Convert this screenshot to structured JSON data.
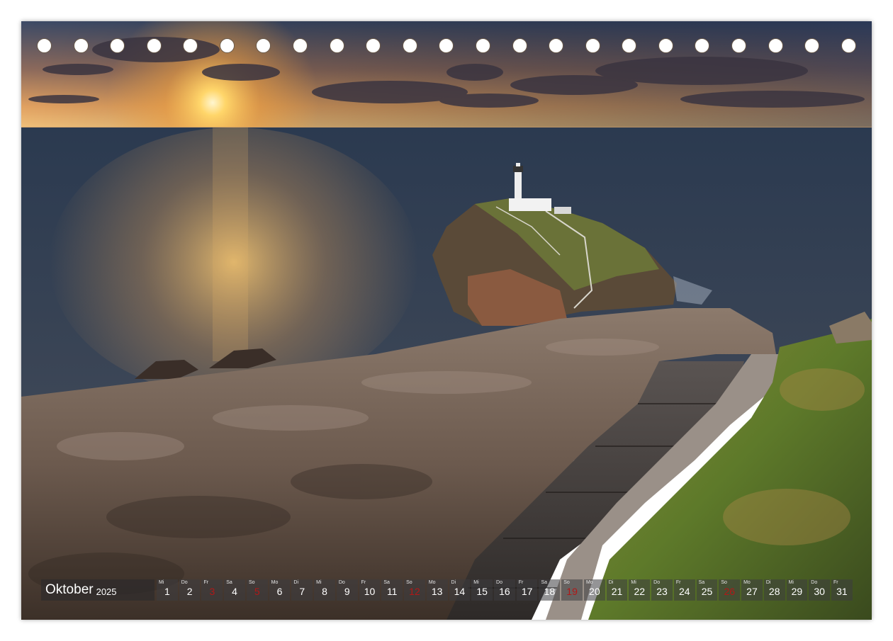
{
  "calendar": {
    "month": "Oktober",
    "year": "2025",
    "weekend_color": "#b11818",
    "days": [
      {
        "dow": "Mi",
        "num": "1",
        "weekend": false
      },
      {
        "dow": "Do",
        "num": "2",
        "weekend": false
      },
      {
        "dow": "Fr",
        "num": "3",
        "weekend": true
      },
      {
        "dow": "Sa",
        "num": "4",
        "weekend": false
      },
      {
        "dow": "So",
        "num": "5",
        "weekend": true
      },
      {
        "dow": "Mo",
        "num": "6",
        "weekend": false
      },
      {
        "dow": "Di",
        "num": "7",
        "weekend": false
      },
      {
        "dow": "Mi",
        "num": "8",
        "weekend": false
      },
      {
        "dow": "Do",
        "num": "9",
        "weekend": false
      },
      {
        "dow": "Fr",
        "num": "10",
        "weekend": false
      },
      {
        "dow": "Sa",
        "num": "11",
        "weekend": false
      },
      {
        "dow": "So",
        "num": "12",
        "weekend": true
      },
      {
        "dow": "Mo",
        "num": "13",
        "weekend": false
      },
      {
        "dow": "Di",
        "num": "14",
        "weekend": false
      },
      {
        "dow": "Mi",
        "num": "15",
        "weekend": false
      },
      {
        "dow": "Do",
        "num": "16",
        "weekend": false
      },
      {
        "dow": "Fr",
        "num": "17",
        "weekend": false
      },
      {
        "dow": "Sa",
        "num": "18",
        "weekend": false
      },
      {
        "dow": "So",
        "num": "19",
        "weekend": true
      },
      {
        "dow": "Mo",
        "num": "20",
        "weekend": false
      },
      {
        "dow": "Di",
        "num": "21",
        "weekend": false
      },
      {
        "dow": "Mi",
        "num": "22",
        "weekend": false
      },
      {
        "dow": "Do",
        "num": "23",
        "weekend": false
      },
      {
        "dow": "Fr",
        "num": "24",
        "weekend": false
      },
      {
        "dow": "Sa",
        "num": "25",
        "weekend": false
      },
      {
        "dow": "So",
        "num": "26",
        "weekend": true
      },
      {
        "dow": "Mo",
        "num": "27",
        "weekend": false
      },
      {
        "dow": "Di",
        "num": "28",
        "weekend": false
      },
      {
        "dow": "Mi",
        "num": "29",
        "weekend": false
      },
      {
        "dow": "Do",
        "num": "30",
        "weekend": false
      },
      {
        "dow": "Fr",
        "num": "31",
        "weekend": false
      }
    ]
  }
}
